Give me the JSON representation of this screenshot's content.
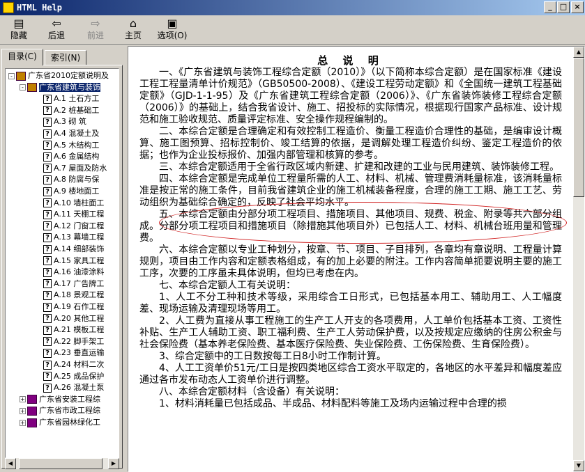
{
  "window": {
    "title": "HTML Help",
    "minimize_label": "_",
    "maximize_label": "□",
    "close_label": "×"
  },
  "toolbar": {
    "hide": {
      "label": "隐藏",
      "icon": "hide-icon"
    },
    "back": {
      "label": "后退",
      "icon": "back-arrow-icon"
    },
    "forward": {
      "label": "前进",
      "icon": "forward-arrow-icon"
    },
    "home": {
      "label": "主页",
      "icon": "home-icon"
    },
    "options": {
      "label": "选项(O)",
      "icon": "options-icon"
    }
  },
  "tabs": {
    "contents": "目录(C)",
    "index": "索引(N)"
  },
  "tree": [
    {
      "level": 0,
      "type": "book-open",
      "pm": "-",
      "label": "广东省2010定额说明及"
    },
    {
      "level": 1,
      "type": "book-open",
      "pm": "-",
      "label": "广东省建筑与装饰",
      "selected": true
    },
    {
      "level": 2,
      "type": "page",
      "label": "A.1  土石方工"
    },
    {
      "level": 2,
      "type": "page",
      "label": "A.2  桩基础工"
    },
    {
      "level": 2,
      "type": "page",
      "label": "A.3  砌  筑"
    },
    {
      "level": 2,
      "type": "page",
      "label": "A.4  混凝土及"
    },
    {
      "level": 2,
      "type": "page",
      "label": "A.5  木结构工"
    },
    {
      "level": 2,
      "type": "page",
      "label": "A.6  金属结构"
    },
    {
      "level": 2,
      "type": "page",
      "label": "A.7 屋面及防水"
    },
    {
      "level": 2,
      "type": "page",
      "label": "A.8  防腐与保"
    },
    {
      "level": 2,
      "type": "page",
      "label": "A.9  楼地面工"
    },
    {
      "level": 2,
      "type": "page",
      "label": "A.10  墙柱面工"
    },
    {
      "level": 2,
      "type": "page",
      "label": "A.11  天棚工程"
    },
    {
      "level": 2,
      "type": "page",
      "label": "A.12  门窗工程"
    },
    {
      "level": 2,
      "type": "page",
      "label": "A.13  幕墙工程"
    },
    {
      "level": 2,
      "type": "page",
      "label": "A.14  细部装饰"
    },
    {
      "level": 2,
      "type": "page",
      "label": "A.15  家具工程"
    },
    {
      "level": 2,
      "type": "page",
      "label": "A.16  油漆涂料"
    },
    {
      "level": 2,
      "type": "page",
      "label": "A.17  广告牌工"
    },
    {
      "level": 2,
      "type": "page",
      "label": "A.18 景观工程"
    },
    {
      "level": 2,
      "type": "page",
      "label": "A.19 石作工程"
    },
    {
      "level": 2,
      "type": "page",
      "label": "A.20  其他工程"
    },
    {
      "level": 2,
      "type": "page",
      "label": "A.21  模板工程"
    },
    {
      "level": 2,
      "type": "page",
      "label": "A.22  脚手架工"
    },
    {
      "level": 2,
      "type": "page",
      "label": "A.23  垂直运输"
    },
    {
      "level": 2,
      "type": "page",
      "label": "A.24  材料二次"
    },
    {
      "level": 2,
      "type": "page",
      "label": "A.25  成品保护"
    },
    {
      "level": 2,
      "type": "page",
      "label": "A.26  混凝土泵"
    },
    {
      "level": 1,
      "type": "book-closed",
      "pm": "+",
      "label": "广东省安装工程综"
    },
    {
      "level": 1,
      "type": "book-closed",
      "pm": "+",
      "label": "广东省市政工程综"
    },
    {
      "level": 1,
      "type": "book-closed",
      "pm": "+",
      "label": "广东省园林绿化工"
    }
  ],
  "document": {
    "title": "总 说 明",
    "paragraphs": [
      "一、《广东省建筑与装饰工程综合定额（2010）》（以下简称本综合定额）是在国家标准《建设工程工程量清单计价规范》（GB50500-2008）、《建设工程劳动定额》和《全国统一建筑工程基础定额》（GJD-1-1-95）及《广东省建筑工程综合定额（2006）》、《广东省装饰装修工程综合定额（2006）》的基础上，结合我省设计、施工、招投标的实际情况，根据现行国家产品标准、设计规范和施工验收规范、质量评定标准、安全操作规程编制的。",
      "二、本综合定额是合理确定和有效控制工程造价、衡量工程造价合理性的基础，是编审设计概算、施工图预算、招标控制价、竣工结算的依据，是调解处理工程造价纠纷、鉴定工程造价的依据；也作为企业投标报价、加强内部管理和核算的参考。",
      "三、本综合定额适用于全省行政区域内新建、扩建和改建的工业与民用建筑、装饰装修工程。",
      "四、本综合定额是完成单位工程量所需的人工、材料、机械、管理费消耗量标准，该消耗量标准是按正常的施工条件，目前我省建筑企业的施工机械装备程度，合理的施工工期、施工工艺、劳动组织为基础综合确定的，反映了社会平均水平。",
      "五、本综合定额由分部分项工程项目、措施项目、其他项目、规费、税金、附录等共六部分组成。分部分项工程项目和措施项目（除措施其他项目外）已包括人工、材料、机械台班用量和管理费。",
      "六、本综合定额以专业工种划分，按章、节、项目、子目排列，各章均有章说明、工程量计算规则，项目由工作内容和定额表格组成，有的加上必要的附注。工作内容简单扼要说明主要的施工工序，次要的工序虽未具体说明，但均已考虑在内。",
      "七、本综合定额人工有关说明：",
      "1、人工不分工种和技术等级，采用综合工日形式，已包括基本用工、辅助用工、人工幅度差、现场运输及清理现场等用工。",
      "2、人工费为直接从事工程施工的生产工人开支的各项费用，人工单价包括基本工资、工资性补贴、生产工人辅助工资、职工福利费、生产工人劳动保护费，以及按规定应缴纳的住房公积金与社会保险费（基本养老保险费、基本医疗保险费、失业保险费、工伤保险费、生育保险费）。",
      "3、综合定额中的工日数按每工日8小时工作制计算。",
      "4、人工工资单价51元/工日是按四类地区综合工资水平取定的，各地区的水平差异和幅度差应通过各市发布动态人工资单价进行调整。",
      "八、本综合定额材料（含设备）有关说明：",
      "1、材料消耗量已包括成品、半成品、材料配料等施工及场内运输过程中合理的损"
    ]
  }
}
